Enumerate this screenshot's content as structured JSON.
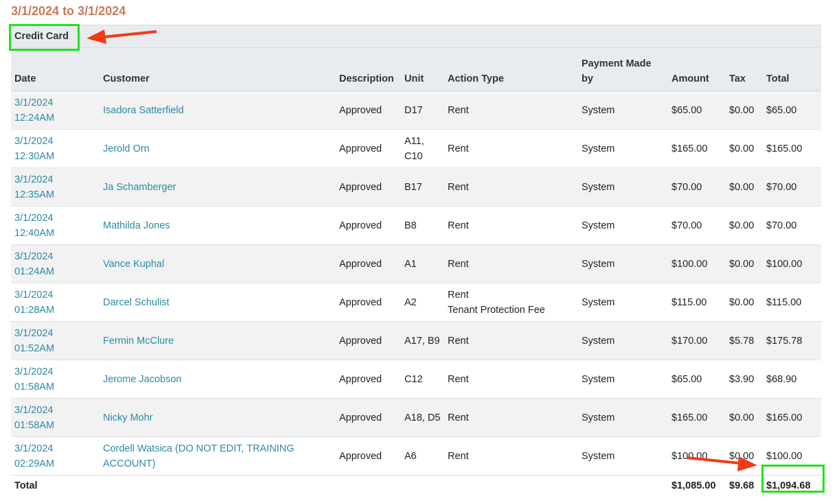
{
  "report": {
    "date_range": "3/1/2024 to 3/1/2024",
    "group_label": "Credit Card",
    "columns": {
      "date": "Date",
      "customer": "Customer",
      "description": "Description",
      "unit": "Unit",
      "action_type": "Action Type",
      "payment_made_by": "Payment Made by",
      "amount": "Amount",
      "tax": "Tax",
      "total": "Total"
    },
    "rows": [
      {
        "date": "3/1/2024",
        "time": "12:24AM",
        "customer": "Isadora Satterfield",
        "description": "Approved",
        "unit": "D17",
        "unit_line2": "",
        "action": "Rent",
        "action_line2": "",
        "payment_made_by": "System",
        "amount": "$65.00",
        "tax": "$0.00",
        "total": "$65.00"
      },
      {
        "date": "3/1/2024",
        "time": "12:30AM",
        "customer": "Jerold Orn",
        "description": "Approved",
        "unit": "A11,",
        "unit_line2": "C10",
        "action": "Rent",
        "action_line2": "",
        "payment_made_by": "System",
        "amount": "$165.00",
        "tax": "$0.00",
        "total": "$165.00"
      },
      {
        "date": "3/1/2024",
        "time": "12:35AM",
        "customer": "Ja Schamberger",
        "description": "Approved",
        "unit": "B17",
        "unit_line2": "",
        "action": "Rent",
        "action_line2": "",
        "payment_made_by": "System",
        "amount": "$70.00",
        "tax": "$0.00",
        "total": "$70.00"
      },
      {
        "date": "3/1/2024",
        "time": "12:40AM",
        "customer": "Mathilda Jones",
        "description": "Approved",
        "unit": "B8",
        "unit_line2": "",
        "action": "Rent",
        "action_line2": "",
        "payment_made_by": "System",
        "amount": "$70.00",
        "tax": "$0.00",
        "total": "$70.00"
      },
      {
        "date": "3/1/2024",
        "time": "01:24AM",
        "customer": "Vance Kuphal",
        "description": "Approved",
        "unit": "A1",
        "unit_line2": "",
        "action": "Rent",
        "action_line2": "",
        "payment_made_by": "System",
        "amount": "$100.00",
        "tax": "$0.00",
        "total": "$100.00"
      },
      {
        "date": "3/1/2024",
        "time": "01:28AM",
        "customer": "Darcel Schulist",
        "description": "Approved",
        "unit": "A2",
        "unit_line2": "",
        "action": "Rent",
        "action_line2": "Tenant Protection Fee",
        "payment_made_by": "System",
        "amount": "$115.00",
        "tax": "$0.00",
        "total": "$115.00"
      },
      {
        "date": "3/1/2024",
        "time": "01:52AM",
        "customer": "Fermin McClure",
        "description": "Approved",
        "unit": "A17, B9",
        "unit_line2": "",
        "action": "Rent",
        "action_line2": "",
        "payment_made_by": "System",
        "amount": "$170.00",
        "tax": "$5.78",
        "total": "$175.78"
      },
      {
        "date": "3/1/2024",
        "time": "01:58AM",
        "customer": "Jerome Jacobson",
        "description": "Approved",
        "unit": "C12",
        "unit_line2": "",
        "action": "Rent",
        "action_line2": "",
        "payment_made_by": "System",
        "amount": "$65.00",
        "tax": "$3.90",
        "total": "$68.90"
      },
      {
        "date": "3/1/2024",
        "time": "01:58AM",
        "customer": "Nicky Mohr",
        "description": "Approved",
        "unit": "A18, D5",
        "unit_line2": "",
        "action": "Rent",
        "action_line2": "",
        "payment_made_by": "System",
        "amount": "$165.00",
        "tax": "$0.00",
        "total": "$165.00"
      },
      {
        "date": "3/1/2024",
        "time": "02:29AM",
        "customer": "Cordell Watsica (DO NOT EDIT, TRAINING ACCOUNT)",
        "description": "Approved",
        "unit": "A6",
        "unit_line2": "",
        "action": "Rent",
        "action_line2": "",
        "payment_made_by": "System",
        "amount": "$100.00",
        "tax": "$0.00",
        "total": "$100.00"
      }
    ],
    "totals": {
      "label": "Total",
      "amount": "$1,085.00",
      "tax": "$9.68",
      "total": "$1,094.68"
    }
  },
  "annotations": {
    "highlight_color": "#22e022",
    "arrow_color": "#f03a17"
  }
}
